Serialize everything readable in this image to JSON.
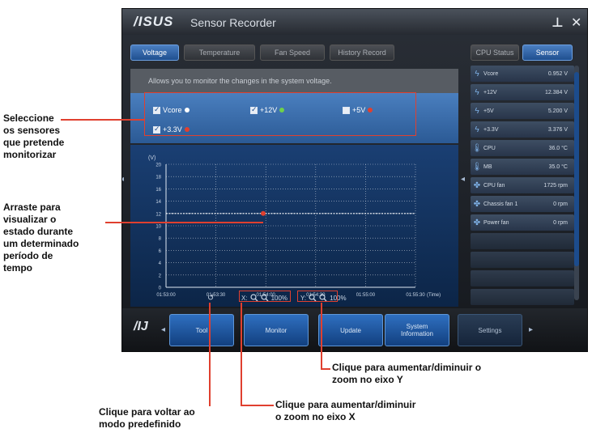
{
  "app": {
    "logo": "/ISUS",
    "title": "Sensor Recorder",
    "minimize_label": "⊥",
    "close_label": "✕"
  },
  "tabs": [
    {
      "label": "Voltage",
      "active": true
    },
    {
      "label": "Temperature",
      "active": false
    },
    {
      "label": "Fan Speed",
      "active": false
    },
    {
      "label": "History Record",
      "active": false
    }
  ],
  "description": "Allows you to monitor the changes in the system voltage.",
  "sensors": [
    {
      "label": "Vcore",
      "checked": true,
      "color": "#ffffff"
    },
    {
      "label": "+12V",
      "checked": true,
      "color": "#6fd24a"
    },
    {
      "label": "+5V",
      "checked": false,
      "color": "#e0402f"
    },
    {
      "label": "+3.3V",
      "checked": true,
      "color": "#e0402f"
    }
  ],
  "chart": {
    "y_unit": "(V)",
    "y_ticks": [
      "20",
      "18",
      "16",
      "14",
      "12",
      "10",
      "8",
      "6",
      "4",
      "2",
      "0"
    ],
    "x_ticks": [
      "01:53:00",
      "01:53:30",
      "01:54:00",
      "01:54:30",
      "01:55:00",
      "01:55:30"
    ],
    "x_unit": "(Time)",
    "grid_color": "#ffffff",
    "series_value": 12
  },
  "zoom_x": {
    "label": "X:",
    "value": "100%"
  },
  "zoom_y": {
    "label": "Y:",
    "value": "100%"
  },
  "right_tabs": [
    {
      "label": "CPU Status",
      "active": false
    },
    {
      "label": "Sensor",
      "active": true
    }
  ],
  "sensor_readings": [
    {
      "icon": "voltage-icon",
      "name": "Vcore",
      "value": "0.952 V"
    },
    {
      "icon": "voltage-icon",
      "name": "+12V",
      "value": "12.384 V"
    },
    {
      "icon": "voltage-icon",
      "name": "+5V",
      "value": "5.200 V"
    },
    {
      "icon": "voltage-icon",
      "name": "+3.3V",
      "value": "3.376 V"
    },
    {
      "icon": "temperature-icon",
      "name": "CPU",
      "value": "36.0 °C"
    },
    {
      "icon": "temperature-icon",
      "name": "MB",
      "value": "35.0 °C"
    },
    {
      "icon": "fan-icon",
      "name": "CPU fan",
      "value": "1725 rpm"
    },
    {
      "icon": "fan-icon",
      "name": "Chassis fan 1",
      "value": "0 rpm"
    },
    {
      "icon": "fan-icon",
      "name": "Power fan",
      "value": "0 rpm"
    }
  ],
  "bottom_nav": {
    "logo": "/IJ",
    "items": [
      {
        "label": "Tool"
      },
      {
        "label": "Monitor"
      },
      {
        "label": "Update"
      },
      {
        "label": "System\nInformation"
      },
      {
        "label": "Settings"
      }
    ]
  },
  "annotations": {
    "select_sensors": "Seleccione\nos sensores\nque pretende\nmonitorizar",
    "drag": "Arraste para\nvisualizar o\nestado durante\num determinado\nperíodo de\ntempo",
    "zoom_y": "Clique para aumentar/diminuir o\nzoom no eixo Y",
    "zoom_x": "Clique para aumentar/diminuir\no zoom no eixo X",
    "reset": "Clique para voltar ao\nmodo predefinido"
  }
}
